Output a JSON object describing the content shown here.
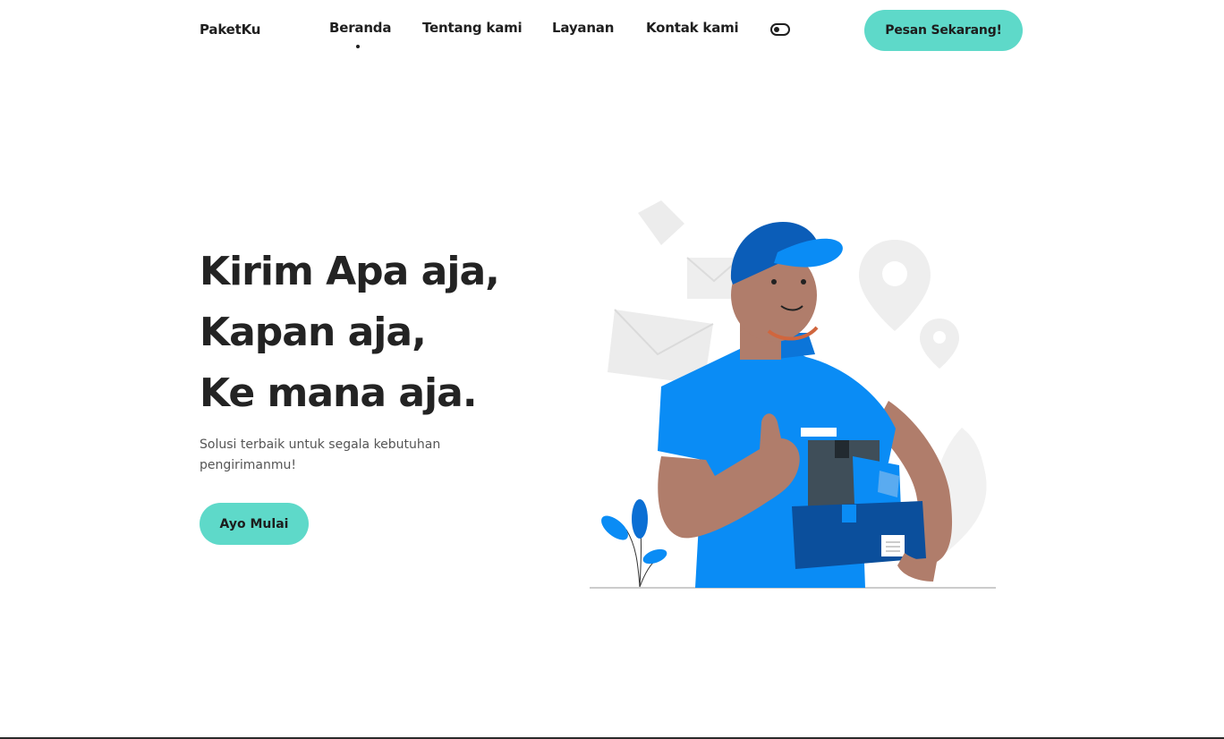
{
  "brand": {
    "name": "PaketKu"
  },
  "nav": {
    "items": [
      {
        "label": "Beranda",
        "active": true
      },
      {
        "label": "Tentang kami"
      },
      {
        "label": "Layanan"
      },
      {
        "label": "Kontak kami"
      }
    ],
    "theme_toggle_icon": "toggle-icon",
    "cta_label": "Pesan Sekarang!"
  },
  "hero": {
    "title_lines": [
      "Kirim Apa aja,",
      "Kapan aja,",
      "Ke mana aja."
    ],
    "subtitle": "Solusi terbaik untuk segala kebutuhan pengirimanmu!",
    "button_label": "Ayo Mulai"
  },
  "colors": {
    "accent": "#5ed9c9",
    "shirt_blue": "#0a8cf5",
    "dark_blue": "#0b4f9c",
    "skin": "#b07d6b",
    "text": "#232323"
  }
}
